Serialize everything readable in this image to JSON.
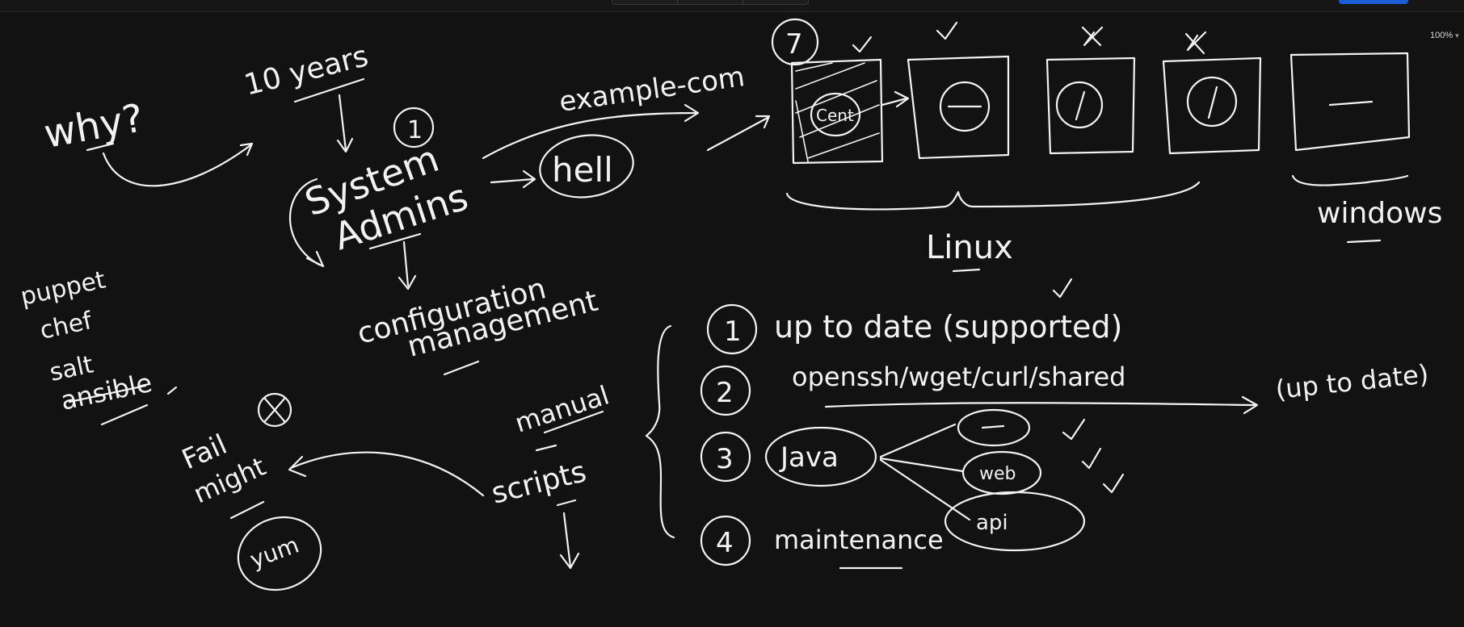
{
  "toolbar": {
    "zoom_level": "100%",
    "zoom_caret": "▾"
  },
  "whiteboard": {
    "why": "why?",
    "years": "10 years",
    "circle_one": "1",
    "system": "System",
    "admins": "Admins",
    "hell": "hell",
    "example": "example-com",
    "config1": "configuration",
    "config2": "management",
    "tools": [
      "puppet",
      "chef",
      "salt",
      "ansible"
    ],
    "fail": "Fail",
    "might": "might",
    "yum": "yum",
    "manual": "manual",
    "scripts": "scripts",
    "box_count": "7",
    "box_label": "Cent",
    "linux": "Linux",
    "windows": "windows",
    "items": [
      {
        "num": "1",
        "text": "up to date (supported)"
      },
      {
        "num": "2",
        "text": "openssh/wget/curl/shared"
      },
      {
        "num": "3",
        "text": "Java"
      },
      {
        "num": "4",
        "text": "maintenance"
      }
    ],
    "up_to_date": "(up to date)",
    "java_web": "web",
    "java_api": "api"
  }
}
